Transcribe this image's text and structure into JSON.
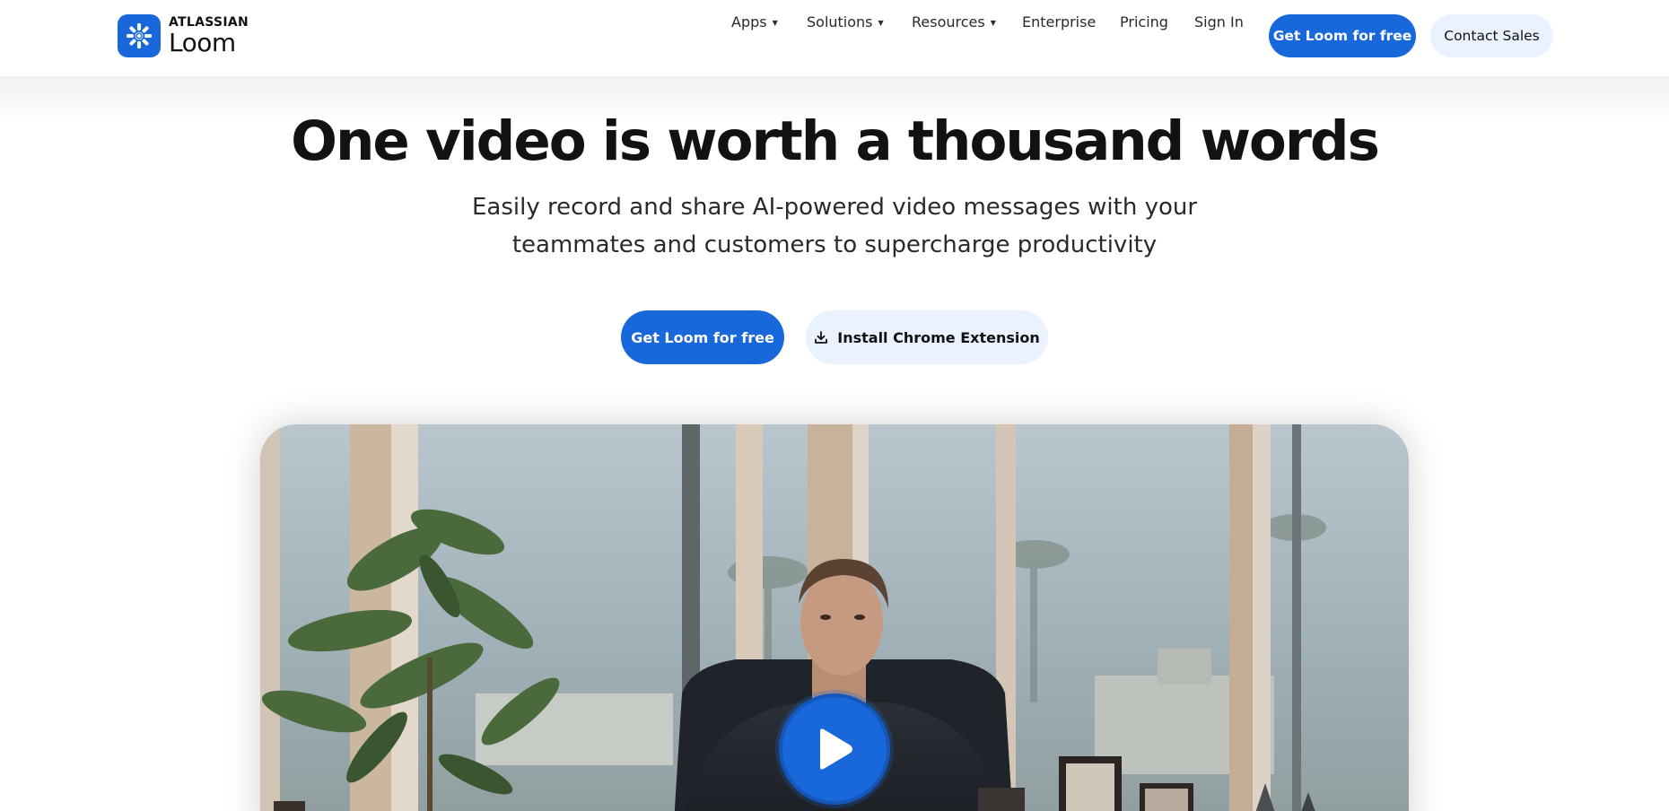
{
  "brand": {
    "company": "ATLASSIAN",
    "product": "Loom",
    "accent": "#1868db",
    "accent_soft": "#e9f2fe"
  },
  "nav": {
    "items": [
      {
        "label": "Apps",
        "has_dropdown": true
      },
      {
        "label": "Solutions",
        "has_dropdown": true
      },
      {
        "label": "Resources",
        "has_dropdown": true
      },
      {
        "label": "Enterprise",
        "has_dropdown": false
      },
      {
        "label": "Pricing",
        "has_dropdown": false
      },
      {
        "label": "Sign In",
        "has_dropdown": false
      }
    ],
    "dropdown_glyph": "▼",
    "primary_cta": "Get Loom for free",
    "secondary_cta": "Contact Sales"
  },
  "hero": {
    "title": "One video is worth a thousand words",
    "subtitle_line1": "Easily record and share AI-powered video messages with your",
    "subtitle_line2": "teammates and customers to supercharge productivity",
    "primary_cta": "Get Loom for free",
    "secondary_cta": "Install Chrome Extension",
    "secondary_cta_icon": "download-icon"
  },
  "video": {
    "play_icon": "play-icon"
  }
}
